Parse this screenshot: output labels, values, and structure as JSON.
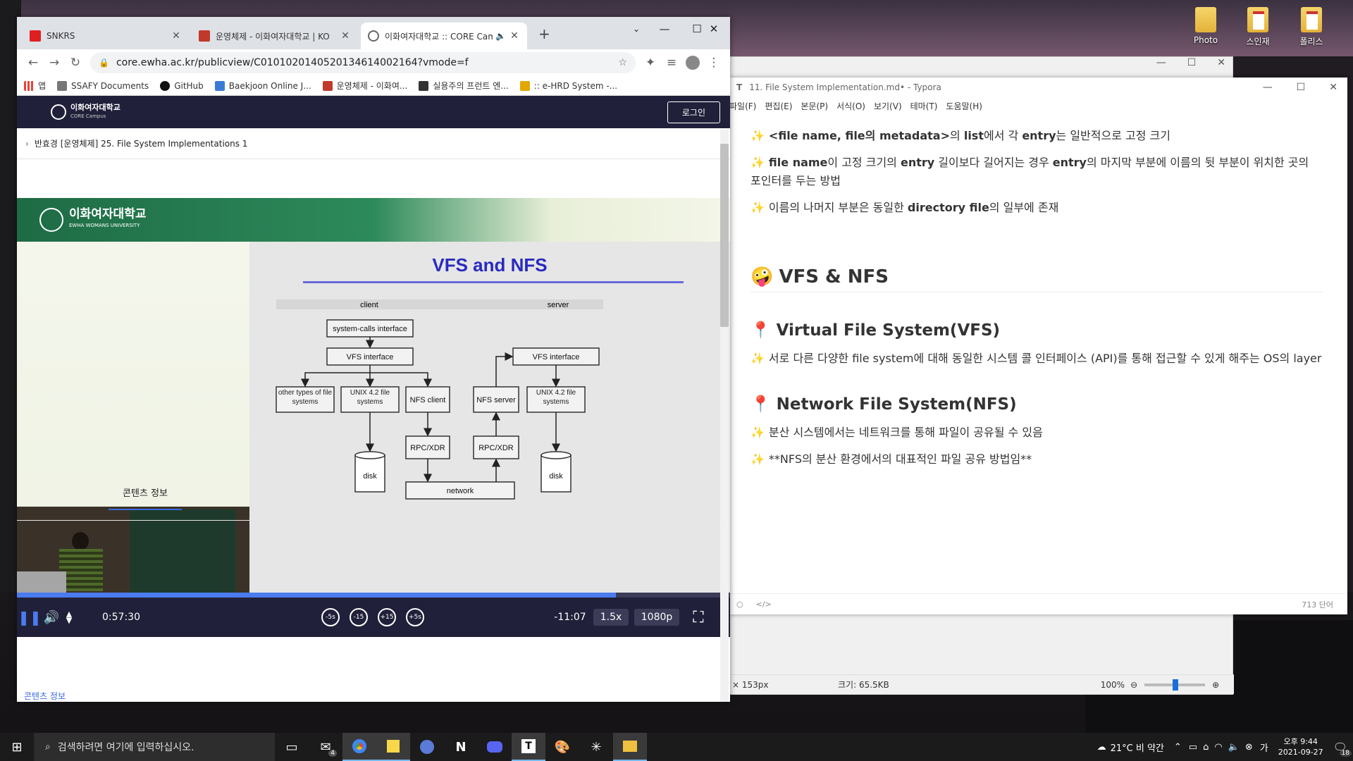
{
  "desktop": {
    "icons": [
      {
        "label": "Photo"
      },
      {
        "label": "스인재"
      },
      {
        "label": "폴리스"
      }
    ]
  },
  "chrome": {
    "tabs": [
      {
        "title": "SNKRS",
        "color": "#e02020"
      },
      {
        "title": "운영체제 - 이화여자대학교 | KO",
        "color": "#c0392b"
      },
      {
        "title": "이화여자대학교 :: CORE Cam",
        "color": "#888888"
      }
    ],
    "new_tab": "+",
    "url": "core.ewha.ac.kr/publicview/C0101020140520134614002164?vmode=f",
    "bookmarks": [
      "앱",
      "SSAFY Documents",
      "GitHub",
      "Baekjoon Online J...",
      "운영체제 - 이화여...",
      "실용주의 프런트 엔...",
      ":: e-HRD System -..."
    ],
    "site": {
      "logo_line1": "이화여자대학교",
      "logo_line2": "CORE Campus",
      "login": "로그인"
    },
    "breadcrumb": "반효경 [운영체제] 25. File System Implementations 1",
    "video": {
      "school": "이화여자대학교",
      "school_en": "EWHA WOMANS UNIVERSITY",
      "slide_title": "VFS and NFS",
      "diagram": {
        "client": "client",
        "server": "server",
        "syscall": "system-calls interface",
        "vfs_client": "VFS interface",
        "vfs_server": "VFS interface",
        "other_fs": "other types of file systems",
        "unix_client": "UNIX 4.2 file systems",
        "nfs_client": "NFS client",
        "nfs_server": "NFS server",
        "unix_server": "UNIX 4.2 file systems",
        "rpc_client": "RPC/XDR",
        "rpc_server": "RPC/XDR",
        "disk_client": "disk",
        "disk_server": "disk",
        "network": "network"
      },
      "progress": 0.84,
      "elapsed": "0:57:30",
      "remaining": "-11:07",
      "speed": "1.5x",
      "quality": "1080p",
      "skip_back_5": "-5s",
      "skip_back_15": "-15",
      "skip_fwd_15": "+15",
      "skip_fwd_5": "+5s"
    },
    "info_tab": "콘텐츠 정보",
    "info_heading": "콘텐츠 정보"
  },
  "typora": {
    "title": "11. File System Implementation.md• - Typora",
    "menu": [
      "파일(F)",
      "편집(E)",
      "본문(P)",
      "서식(O)",
      "보기(V)",
      "테마(T)",
      "도움말(H)"
    ],
    "content": [
      {
        "type": "p",
        "html": "<b>&lt;file name, file의 metadata&gt;</b>의 <b>list</b>에서 각 <b>entry</b>는 일반적으로 고정 크기"
      },
      {
        "type": "p",
        "html": "<b>file name</b>이 고정 크기의 <b>entry</b> 길이보다 길어지는 경우 <b>entry</b>의 마지막 부분에 이름의 뒷 부분이 위치한 곳의 포인터를 두는 방법"
      },
      {
        "type": "p",
        "html": "이름의 나머지 부분은 동일한 <b>directory file</b>의 일부에 존재"
      }
    ],
    "h2": "VFS & NFS",
    "h3_vfs": "Virtual File System(VFS)",
    "vfs_desc": "서로 다른 다양한 file system에 대해 동일한 시스템 콜 인터페이스 (API)를 통해 접근할 수 있게 해주는 OS의 layer",
    "h3_nfs": "Network File System(NFS)",
    "nfs_1": "분산 시스템에서는 네트워크를 통해 파일이 공유될 수 있음",
    "nfs_2": "**NFS의 분산 환경에서의 대표적인 파일 공유 방법임**",
    "word_count": "713 단어"
  },
  "viewer": {
    "dims": "× 153px",
    "size": "크기: 65.5KB",
    "zoom": "100%"
  },
  "taskbar": {
    "search_placeholder": "검색하려면 여기에 입력하십시오.",
    "weather": "21°C 비 약간",
    "time": "오후 9:44",
    "date": "2021-09-27",
    "notif": "18",
    "mail_badge": "4"
  }
}
